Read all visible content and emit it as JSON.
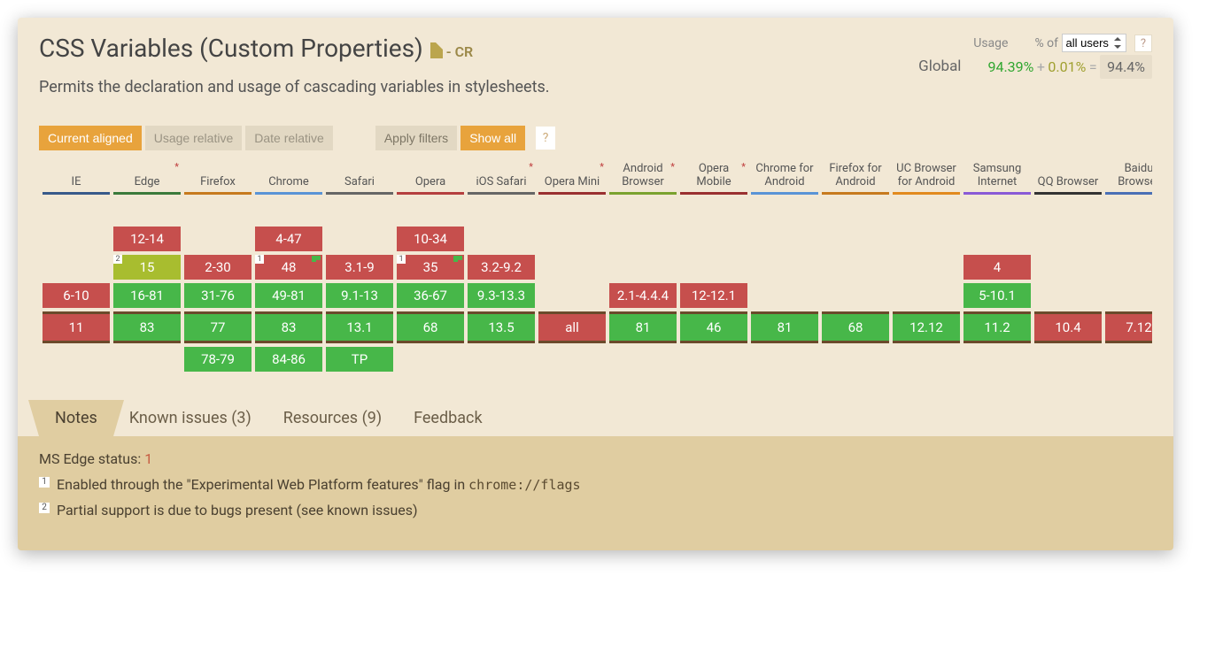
{
  "title": "CSS Variables (Custom Properties)",
  "status": " - CR",
  "description": "Permits the declaration and usage of cascading variables in stylesheets.",
  "usage": {
    "label": "Usage",
    "global_label": "Global",
    "pct_of": "% of",
    "scope": "all users",
    "help": "?",
    "supported": "94.39%",
    "plus": "+",
    "partial": "0.01%",
    "equals": "=",
    "total": "94.4%"
  },
  "controls": {
    "current_aligned": "Current aligned",
    "usage_relative": "Usage relative",
    "date_relative": "Date relative",
    "apply_filters": "Apply filters",
    "show_all": "Show all",
    "help": "?"
  },
  "browsers": [
    {
      "name": "IE",
      "cls": "underline-ie",
      "rows": [
        "",
        "",
        "",
        "6-10"
      ],
      "colors": [
        "",
        "",
        "",
        "red"
      ],
      "current": "11",
      "ccolor": "red",
      "future": "",
      "fcolor": ""
    },
    {
      "name": "Edge",
      "ast": true,
      "cls": "underline-edge",
      "rows": [
        "",
        "12-14",
        "15",
        "16-81"
      ],
      "colors": [
        "",
        "red",
        "olive",
        "green"
      ],
      "badges": {
        "2": "2"
      },
      "current": "83",
      "ccolor": "green",
      "future": "",
      "fcolor": ""
    },
    {
      "name": "Firefox",
      "cls": "underline-ff",
      "rows": [
        "",
        "",
        "2-30",
        "31-76"
      ],
      "colors": [
        "",
        "",
        "red",
        "green"
      ],
      "current": "77",
      "ccolor": "green",
      "future": "78-79",
      "fcolor": "green"
    },
    {
      "name": "Chrome",
      "cls": "underline-chrome",
      "rows": [
        "",
        "4-47",
        "48",
        "49-81"
      ],
      "colors": [
        "",
        "red",
        "red",
        "green"
      ],
      "badges": {
        "2": "1"
      },
      "flags": {
        "2": true
      },
      "current": "83",
      "ccolor": "green",
      "future": "84-86",
      "fcolor": "green"
    },
    {
      "name": "Safari",
      "cls": "underline-safari",
      "rows": [
        "",
        "",
        "3.1-9",
        "9.1-13"
      ],
      "colors": [
        "",
        "",
        "red",
        "green"
      ],
      "current": "13.1",
      "ccolor": "green",
      "future": "TP",
      "fcolor": "green"
    },
    {
      "name": "Opera",
      "cls": "underline-opera",
      "rows": [
        "",
        "10-34",
        "35",
        "36-67"
      ],
      "colors": [
        "",
        "red",
        "red",
        "green"
      ],
      "badges": {
        "2": "1"
      },
      "flags": {
        "2": true
      },
      "current": "68",
      "ccolor": "green",
      "future": "",
      "fcolor": ""
    },
    {
      "name": "iOS Safari",
      "ast": true,
      "cls": "underline-ios",
      "rows": [
        "",
        "",
        "3.2-9.2",
        "9.3-13.3"
      ],
      "colors": [
        "",
        "",
        "red",
        "green"
      ],
      "current": "13.5",
      "ccolor": "green",
      "future": "",
      "fcolor": ""
    },
    {
      "name": "Opera Mini",
      "ast": true,
      "cls": "underline-omini",
      "rows": [
        "",
        "",
        "",
        ""
      ],
      "colors": [
        "",
        "",
        "",
        ""
      ],
      "current": "all",
      "ccolor": "red",
      "future": "",
      "fcolor": ""
    },
    {
      "name": "Android Browser",
      "ast": true,
      "cls": "underline-android",
      "rows": [
        "",
        "",
        "",
        "2.1-4.4.4"
      ],
      "colors": [
        "",
        "",
        "",
        "red"
      ],
      "current": "81",
      "ccolor": "green",
      "future": "",
      "fcolor": ""
    },
    {
      "name": "Opera Mobile",
      "ast": true,
      "cls": "underline-omob",
      "rows": [
        "",
        "",
        "",
        "12-12.1"
      ],
      "colors": [
        "",
        "",
        "",
        "red"
      ],
      "current": "46",
      "ccolor": "green",
      "future": "",
      "fcolor": ""
    },
    {
      "name": "Chrome for Android",
      "cls": "underline-cra",
      "rows": [
        "",
        "",
        "",
        ""
      ],
      "colors": [
        "",
        "",
        "",
        ""
      ],
      "current": "81",
      "ccolor": "green",
      "future": "",
      "fcolor": ""
    },
    {
      "name": "Firefox for Android",
      "cls": "underline-ffa",
      "rows": [
        "",
        "",
        "",
        ""
      ],
      "colors": [
        "",
        "",
        "",
        ""
      ],
      "current": "68",
      "ccolor": "green",
      "future": "",
      "fcolor": ""
    },
    {
      "name": "UC Browser for Android",
      "cls": "underline-uc",
      "rows": [
        "",
        "",
        "",
        ""
      ],
      "colors": [
        "",
        "",
        "",
        ""
      ],
      "current": "12.12",
      "ccolor": "green",
      "future": "",
      "fcolor": ""
    },
    {
      "name": "Samsung Internet",
      "cls": "underline-samsung",
      "rows": [
        "",
        "",
        "4",
        "5-10.1"
      ],
      "colors": [
        "",
        "",
        "red",
        "green"
      ],
      "current": "11.2",
      "ccolor": "green",
      "future": "",
      "fcolor": ""
    },
    {
      "name": "QQ Browser",
      "cls": "underline-qq",
      "rows": [
        "",
        "",
        "",
        ""
      ],
      "colors": [
        "",
        "",
        "",
        ""
      ],
      "current": "10.4",
      "ccolor": "red",
      "future": "",
      "fcolor": ""
    },
    {
      "name": "Baidu Browser",
      "cls": "underline-baidu",
      "rows": [
        "",
        "",
        "",
        ""
      ],
      "colors": [
        "",
        "",
        "",
        ""
      ],
      "current": "7.12",
      "ccolor": "red",
      "future": "",
      "fcolor": ""
    }
  ],
  "tabs": {
    "notes": "Notes",
    "issues": "Known issues (3)",
    "resources": "Resources (9)",
    "feedback": "Feedback"
  },
  "notes": {
    "edge_status_label": "MS Edge status: ",
    "edge_status_value": "1",
    "note1": "Enabled through the \"Experimental Web Platform features\" flag in ",
    "note1_code": "chrome://flags",
    "note2": "Partial support is due to bugs present (see known issues)"
  }
}
